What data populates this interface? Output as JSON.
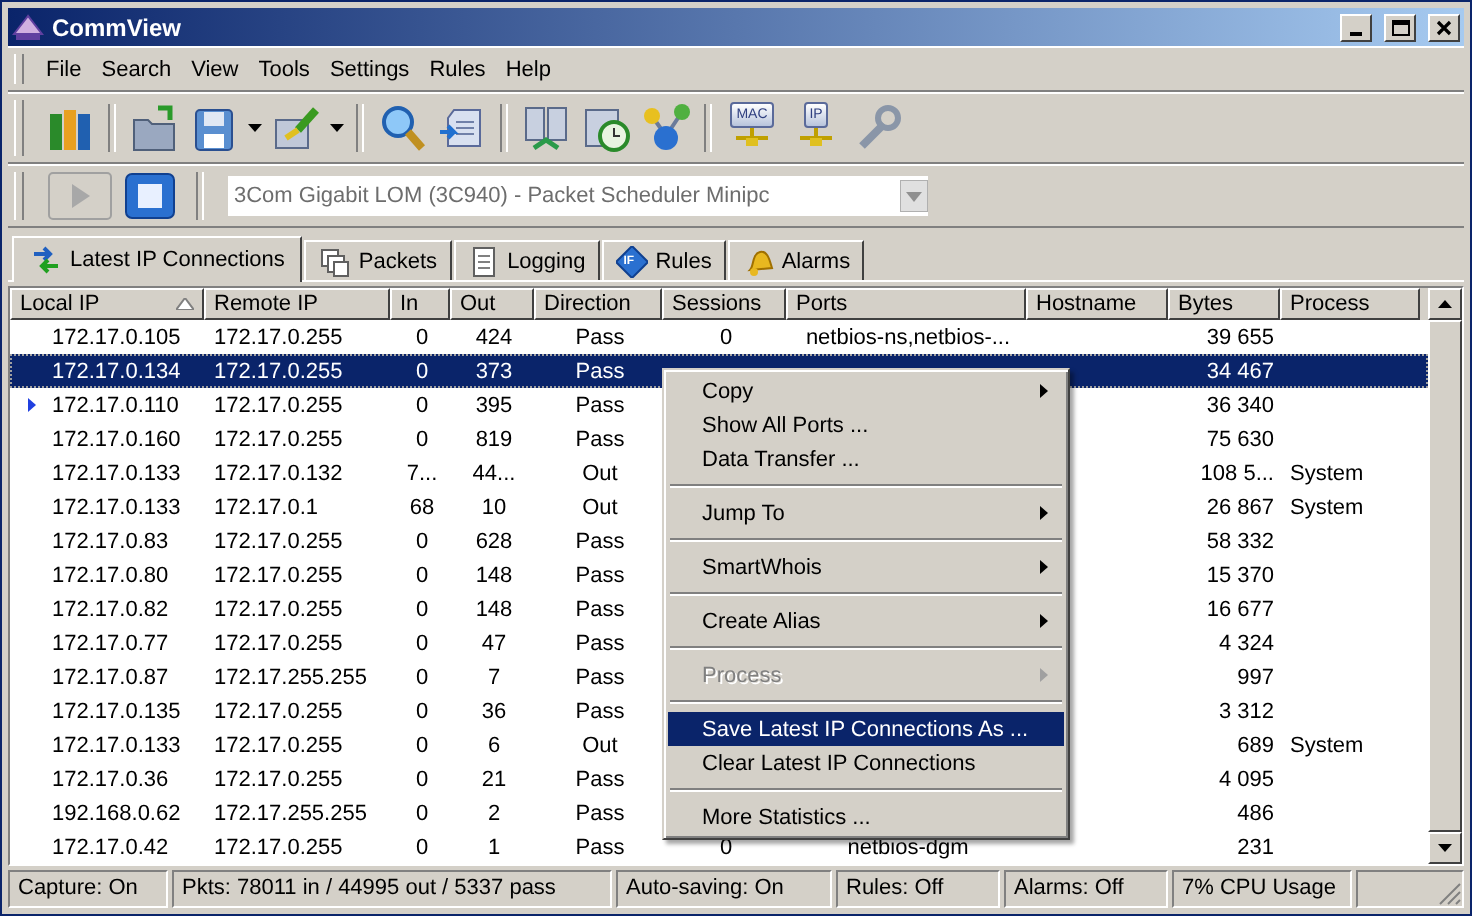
{
  "window": {
    "title": "CommView"
  },
  "menu_bar": [
    "File",
    "Search",
    "View",
    "Tools",
    "Settings",
    "Rules",
    "Help"
  ],
  "toolbar": [
    {
      "kind": "columns"
    },
    {
      "kind": "separator"
    },
    {
      "kind": "folder"
    },
    {
      "kind": "floppy"
    },
    {
      "kind": "caret"
    },
    {
      "kind": "brush"
    },
    {
      "kind": "caret"
    },
    {
      "kind": "separator"
    },
    {
      "kind": "search"
    },
    {
      "kind": "document"
    },
    {
      "kind": "separator"
    },
    {
      "kind": "servers"
    },
    {
      "kind": "clock"
    },
    {
      "kind": "nodes"
    },
    {
      "kind": "separator"
    },
    {
      "kind": "network",
      "label": "MAC"
    },
    {
      "kind": "network",
      "label": "IP"
    },
    {
      "kind": "wrench"
    }
  ],
  "capture": {
    "start_disabled": true,
    "adapter": "3Com Gigabit LOM (3C940) - Packet Scheduler Minipc"
  },
  "tabs": [
    {
      "label": "Latest IP Connections",
      "selected": true
    },
    {
      "label": "Packets",
      "selected": false
    },
    {
      "label": "Logging",
      "selected": false
    },
    {
      "label": "Rules",
      "selected": false,
      "icon_text": "IF"
    },
    {
      "label": "Alarms",
      "selected": false
    }
  ],
  "table": {
    "columns": [
      {
        "label": "Local IP",
        "sorted": true
      },
      {
        "label": "Remote IP",
        "sorted": false
      },
      {
        "label": "In",
        "sorted": false
      },
      {
        "label": "Out",
        "sorted": false
      },
      {
        "label": "Direction",
        "sorted": false
      },
      {
        "label": "Sessions",
        "sorted": false
      },
      {
        "label": "Ports",
        "sorted": false
      },
      {
        "label": "Hostname",
        "sorted": false
      },
      {
        "label": "Bytes",
        "sorted": false
      },
      {
        "label": "Process",
        "sorted": false
      }
    ],
    "rows": [
      {
        "selected": false,
        "current": false,
        "local_ip": "172.17.0.105",
        "remote_ip": "172.17.0.255",
        "in": "0",
        "out": "424",
        "direction": "Pass",
        "sessions": "0",
        "ports": "netbios-ns,netbios-...",
        "bytes": "39 655"
      },
      {
        "selected": true,
        "current": false,
        "local_ip": "172.17.0.134",
        "remote_ip": "172.17.0.255",
        "in": "0",
        "out": "373",
        "direction": "Pass",
        "bytes": "34 467"
      },
      {
        "selected": false,
        "current": true,
        "local_ip": "172.17.0.110",
        "remote_ip": "172.17.0.255",
        "in": "0",
        "out": "395",
        "direction": "Pass",
        "bytes": "36 340"
      },
      {
        "selected": false,
        "current": false,
        "local_ip": "172.17.0.160",
        "remote_ip": "172.17.0.255",
        "in": "0",
        "out": "819",
        "direction": "Pass",
        "bytes": "75 630"
      },
      {
        "selected": false,
        "current": false,
        "local_ip": "172.17.0.133",
        "remote_ip": "172.17.0.132",
        "in": "7...",
        "out": "44...",
        "direction": "Out",
        "bytes": "108 5...",
        "process": "System"
      },
      {
        "selected": false,
        "current": false,
        "local_ip": "172.17.0.133",
        "remote_ip": "172.17.0.1",
        "in": "68",
        "out": "10",
        "direction": "Out",
        "bytes": "26 867",
        "process": "System"
      },
      {
        "selected": false,
        "current": false,
        "local_ip": "172.17.0.83",
        "remote_ip": "172.17.0.255",
        "in": "0",
        "out": "628",
        "direction": "Pass",
        "bytes": "58 332"
      },
      {
        "selected": false,
        "current": false,
        "local_ip": "172.17.0.80",
        "remote_ip": "172.17.0.255",
        "in": "0",
        "out": "148",
        "direction": "Pass",
        "bytes": "15 370"
      },
      {
        "selected": false,
        "current": false,
        "local_ip": "172.17.0.82",
        "remote_ip": "172.17.0.255",
        "in": "0",
        "out": "148",
        "direction": "Pass",
        "bytes": "16 677"
      },
      {
        "selected": false,
        "current": false,
        "local_ip": "172.17.0.77",
        "remote_ip": "172.17.0.255",
        "in": "0",
        "out": "47",
        "direction": "Pass",
        "bytes": "4 324"
      },
      {
        "selected": false,
        "current": false,
        "local_ip": "172.17.0.87",
        "remote_ip": "172.17.255.255",
        "in": "0",
        "out": "7",
        "direction": "Pass",
        "bytes": "997"
      },
      {
        "selected": false,
        "current": false,
        "local_ip": "172.17.0.135",
        "remote_ip": "172.17.0.255",
        "in": "0",
        "out": "36",
        "direction": "Pass",
        "bytes": "3 312"
      },
      {
        "selected": false,
        "current": false,
        "local_ip": "172.17.0.133",
        "remote_ip": "172.17.0.255",
        "in": "0",
        "out": "6",
        "direction": "Out",
        "bytes": "689",
        "process": "System"
      },
      {
        "selected": false,
        "current": false,
        "local_ip": "172.17.0.36",
        "remote_ip": "172.17.0.255",
        "in": "0",
        "out": "21",
        "direction": "Pass",
        "bytes": "4 095"
      },
      {
        "selected": false,
        "current": false,
        "local_ip": "192.168.0.62",
        "remote_ip": "172.17.255.255",
        "in": "0",
        "out": "2",
        "direction": "Pass",
        "bytes": "486"
      },
      {
        "selected": false,
        "current": false,
        "local_ip": "172.17.0.42",
        "remote_ip": "172.17.0.255",
        "in": "0",
        "out": "1",
        "direction": "Pass",
        "sessions": "0",
        "ports": "netbios-dgm",
        "bytes": "231"
      }
    ]
  },
  "context_menu": [
    {
      "kind": "item",
      "label": "Copy",
      "submenu": true,
      "disabled": false,
      "selected": false
    },
    {
      "kind": "item",
      "label": "Show All Ports ...",
      "submenu": false,
      "disabled": false,
      "selected": false
    },
    {
      "kind": "item",
      "label": "Data Transfer ...",
      "submenu": false,
      "disabled": false,
      "selected": false
    },
    {
      "kind": "separator"
    },
    {
      "kind": "item",
      "label": "Jump To",
      "submenu": true,
      "disabled": false,
      "selected": false
    },
    {
      "kind": "separator"
    },
    {
      "kind": "item",
      "label": "SmartWhois",
      "submenu": true,
      "disabled": false,
      "selected": false
    },
    {
      "kind": "separator"
    },
    {
      "kind": "item",
      "label": "Create Alias",
      "submenu": true,
      "disabled": false,
      "selected": false
    },
    {
      "kind": "separator"
    },
    {
      "kind": "item",
      "label": "Process",
      "submenu": true,
      "disabled": true,
      "selected": false
    },
    {
      "kind": "separator"
    },
    {
      "kind": "item",
      "label": "Save Latest IP Connections As ...",
      "submenu": false,
      "disabled": false,
      "selected": true
    },
    {
      "kind": "item",
      "label": "Clear Latest IP Connections",
      "submenu": false,
      "disabled": false,
      "selected": false
    },
    {
      "kind": "separator"
    },
    {
      "kind": "item",
      "label": "More Statistics ...",
      "submenu": false,
      "disabled": false,
      "selected": false
    }
  ],
  "status_bar": [
    "Capture: On",
    "Pkts: 78011 in / 44995 out / 5337 pass",
    "Auto-saving: On",
    "Rules: Off",
    "Alarms: Off",
    "7% CPU Usage"
  ]
}
